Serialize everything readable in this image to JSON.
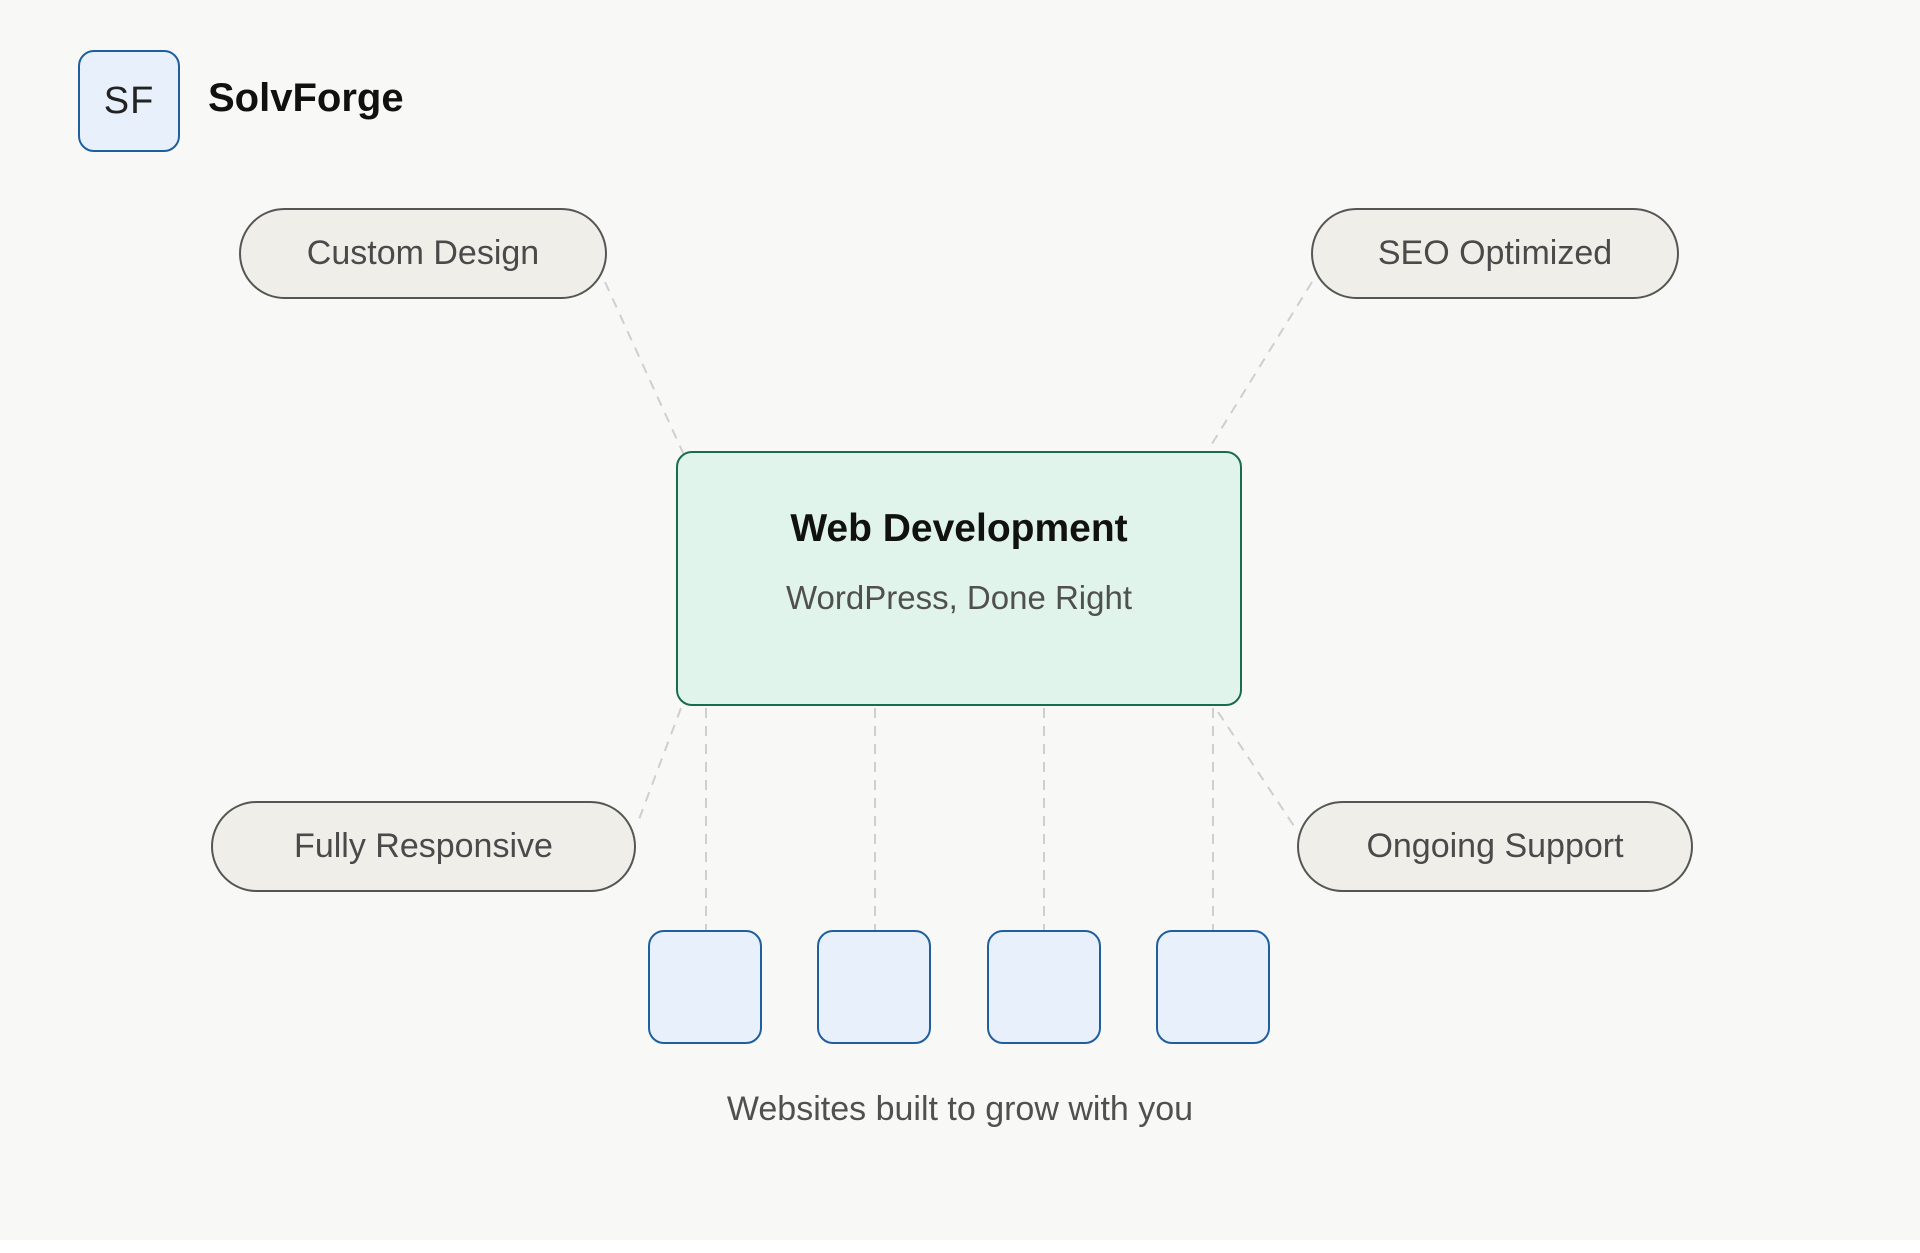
{
  "brand": {
    "logo_text": "SF",
    "name": "SolvForge"
  },
  "center": {
    "title": "Web Development",
    "subtitle": "WordPress, Done Right"
  },
  "features": [
    {
      "label": "Custom Design"
    },
    {
      "label": "SEO Optimized"
    },
    {
      "label": "Fully Responsive"
    },
    {
      "label": "Ongoing Support"
    }
  ],
  "tagline": "Websites built to grow with you",
  "colors": {
    "background": "#f8f8f6",
    "accent_green": "#1a6b50",
    "center_fill": "#e0f4ec",
    "accent_blue": "#1f5f9e",
    "blue_fill": "#e7f0fb",
    "pill_fill": "#f0eee8",
    "pill_border": "#555555"
  }
}
